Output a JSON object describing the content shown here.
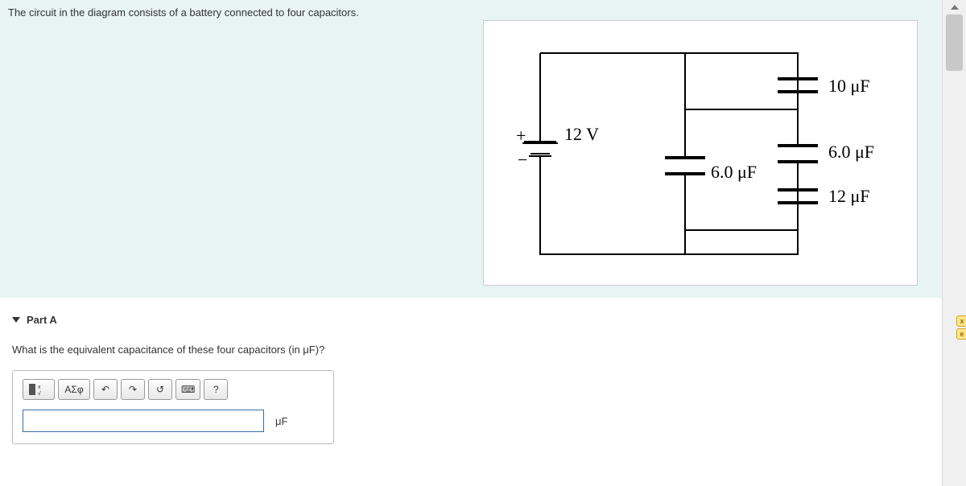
{
  "problem": {
    "statement": "The circuit in the diagram consists of a battery connected to four capacitors."
  },
  "diagram": {
    "voltage": "12 V",
    "plus": "+",
    "minus": "−",
    "cap_top": "10 μF",
    "cap_mid_right": "6.0 μF",
    "cap_bottom": "12 μF",
    "cap_left": "6.0 μF"
  },
  "part": {
    "label": "Part A",
    "question": "What is the equivalent capacitance of these four capacitors (in μF)?"
  },
  "toolbar": {
    "templates": "x²/√",
    "greek": "ΑΣφ",
    "undo": "↶",
    "redo": "↷",
    "reset": "↺",
    "keyboard": "⌨",
    "help": "?"
  },
  "answer": {
    "value": "",
    "unit": "μF"
  },
  "side": {
    "close": "x",
    "info": "e"
  }
}
